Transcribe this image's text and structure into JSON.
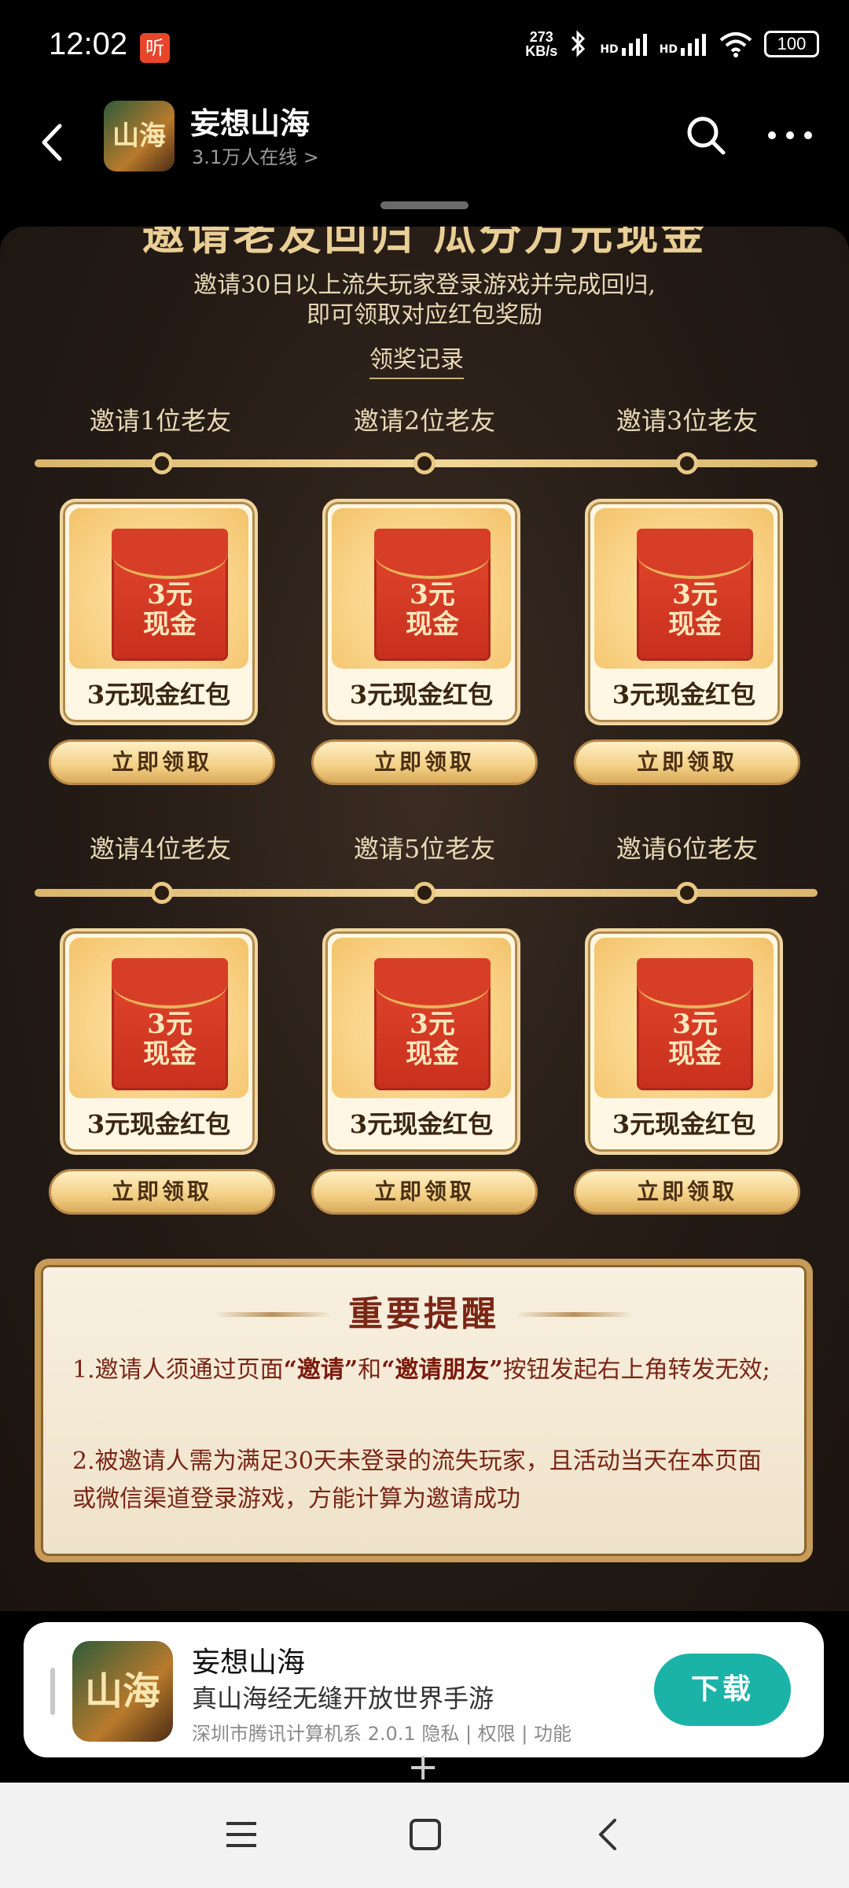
{
  "status_bar": {
    "time": "12:02",
    "badge": "听",
    "net_speed_value": "273",
    "net_speed_unit": "KB/s",
    "signal_1": "HD",
    "signal_2": "HD",
    "battery": "100"
  },
  "header": {
    "title": "妄想山海",
    "online": "3.1万人在线 >",
    "icon_text": "山海"
  },
  "panel": {
    "title": "邀请老友回归 瓜分万元现金",
    "subtitle_line1": "邀请30日以上流失玩家登录游戏并完成回归,",
    "subtitle_line2": "即可领取对应红包奖励",
    "record_link": "领奖记录"
  },
  "tiers": [
    {
      "label": "邀请1位老友",
      "env_text_1": "3元",
      "env_text_2": "现金",
      "card_label": "3元现金红包",
      "button": "立即领取"
    },
    {
      "label": "邀请2位老友",
      "env_text_1": "3元",
      "env_text_2": "现金",
      "card_label": "3元现金红包",
      "button": "立即领取"
    },
    {
      "label": "邀请3位老友",
      "env_text_1": "3元",
      "env_text_2": "现金",
      "card_label": "3元现金红包",
      "button": "立即领取"
    },
    {
      "label": "邀请4位老友",
      "env_text_1": "3元",
      "env_text_2": "现金",
      "card_label": "3元现金红包",
      "button": "立即领取"
    },
    {
      "label": "邀请5位老友",
      "env_text_1": "3元",
      "env_text_2": "现金",
      "card_label": "3元现金红包",
      "button": "立即领取"
    },
    {
      "label": "邀请6位老友",
      "env_text_1": "3元",
      "env_text_2": "现金",
      "card_label": "3元现金红包",
      "button": "立即领取"
    }
  ],
  "notice": {
    "title": "重要提醒",
    "item1_a": "1.邀请人须通过页面",
    "item1_hl1": "“邀请”",
    "item1_b": "和",
    "item1_hl2": "“邀请朋友”",
    "item1_c": "按钮发起右上角转发无效;",
    "item2": "2.被邀请人需为满足30天未登录的流失玩家，且活动当天在本页面或微信渠道登录游戏，方能计算为邀请成功"
  },
  "app_sheet": {
    "icon_text": "山海",
    "name": "妄想山海",
    "desc": "真山海经无缝开放世界手游",
    "meta": "深圳市腾讯计算机系 2.0.1  隐私 | 权限 | 功能",
    "download": "下载"
  },
  "misc": {
    "plus": "+"
  },
  "colors": {
    "accent_teal": "#1bb3a8",
    "envelope_red": "#c8301e",
    "gold": "#e9c884",
    "notice_text": "#7a2616"
  }
}
